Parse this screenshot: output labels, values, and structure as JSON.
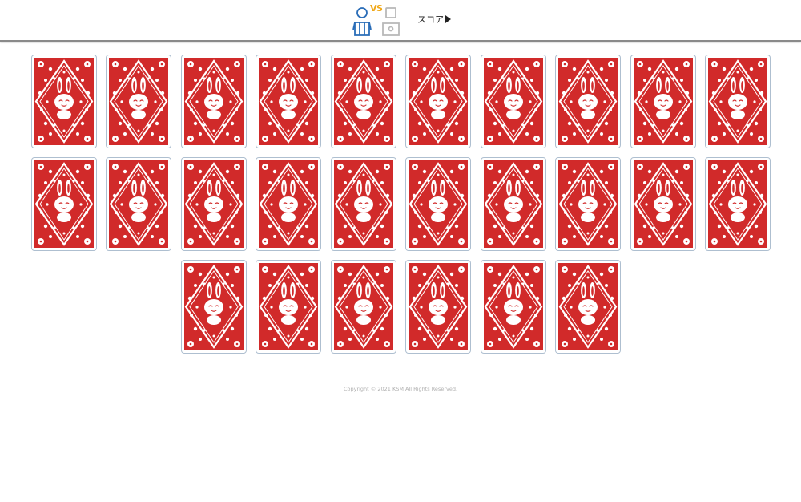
{
  "header": {
    "vs_label": "VS",
    "score_label": "スコア",
    "player_icon": "player-person-icon",
    "opponent_icon": "opponent-robot-icon",
    "colors": {
      "player": "#2a6db8",
      "opponent": "#b8b8b8",
      "vs": "#f0a818"
    }
  },
  "board": {
    "card_back": "rabbit-card-back",
    "card_color": "#d12a2a",
    "rows": [
      10,
      10,
      6
    ],
    "total_cards": 26
  },
  "footer": {
    "copyright": "Copyright © 2021 KSM All Rights Reserved."
  }
}
